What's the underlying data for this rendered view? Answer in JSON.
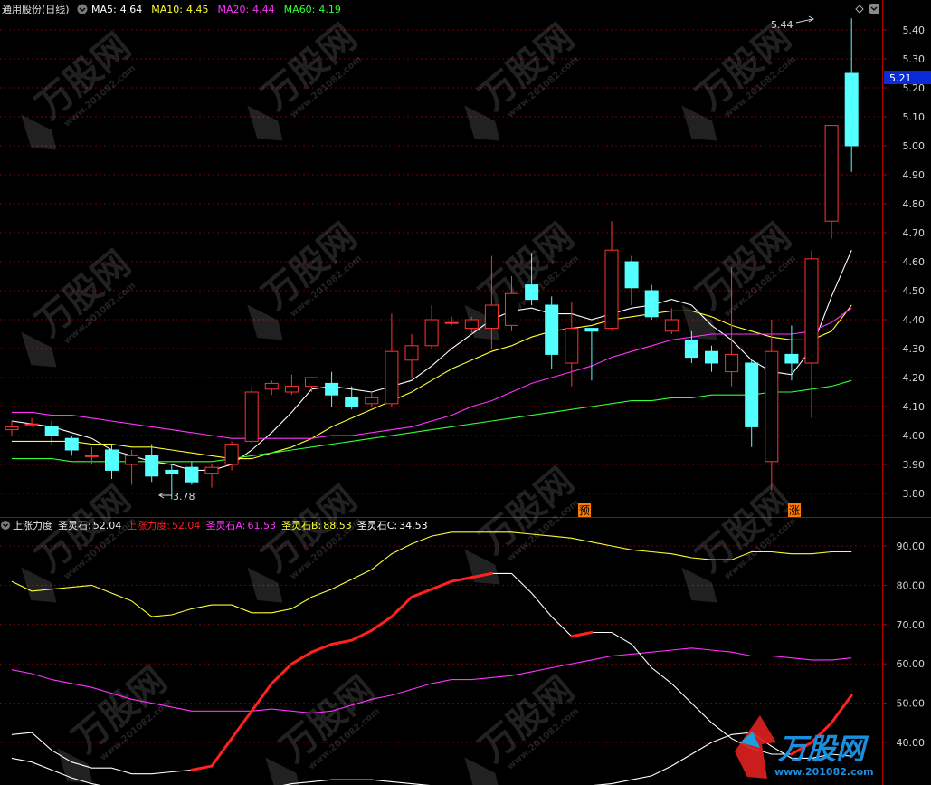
{
  "header": {
    "title": "通用股份(日线)",
    "ma": [
      {
        "label": "MA5:",
        "value": "4.64",
        "color": "#ffffff"
      },
      {
        "label": "MA10:",
        "value": "4.45",
        "color": "#ffff33"
      },
      {
        "label": "MA20:",
        "value": "4.44",
        "color": "#ff33ff"
      },
      {
        "label": "MA60:",
        "value": "4.19",
        "color": "#33ff33"
      }
    ]
  },
  "indicator_header": {
    "name": "上涨力度",
    "name_value_label": "圣灵石:",
    "name_value": "52.04",
    "items": [
      {
        "label": "上涨力度:",
        "value": "52.04",
        "color": "#ff2020"
      },
      {
        "label": "圣灵石A:",
        "value": "61.53",
        "color": "#ff33ff"
      },
      {
        "label": "圣灵石B:",
        "value": "88.53",
        "color": "#ffff33"
      },
      {
        "label": "圣灵石C:",
        "value": "34.53",
        "color": "#ffffff"
      }
    ]
  },
  "markers": {
    "yu": "预",
    "zhang": "涨",
    "high_label": "5.44",
    "low_label": "3.78",
    "current_price": "5.21"
  },
  "watermark": {
    "brand": "万股网",
    "url": "www.201082.com"
  },
  "chart_data": [
    {
      "type": "candlestick",
      "title": "通用股份(日线)",
      "ylim": [
        3.72,
        5.5
      ],
      "y_ticks": [
        3.8,
        3.9,
        4.0,
        4.1,
        4.2,
        4.3,
        4.4,
        4.5,
        4.6,
        4.7,
        4.8,
        4.9,
        5.0,
        5.1,
        5.2,
        5.3,
        5.4
      ],
      "candles": [
        {
          "o": 4.02,
          "h": 4.05,
          "l": 4.0,
          "c": 4.03
        },
        {
          "o": 4.04,
          "h": 4.06,
          "l": 4.03,
          "c": 4.04
        },
        {
          "o": 4.03,
          "h": 4.05,
          "l": 3.97,
          "c": 4.0
        },
        {
          "o": 3.99,
          "h": 4.0,
          "l": 3.93,
          "c": 3.95
        },
        {
          "o": 3.93,
          "h": 3.96,
          "l": 3.9,
          "c": 3.93
        },
        {
          "o": 3.95,
          "h": 3.97,
          "l": 3.85,
          "c": 3.88
        },
        {
          "o": 3.9,
          "h": 3.95,
          "l": 3.83,
          "c": 3.93
        },
        {
          "o": 3.93,
          "h": 3.97,
          "l": 3.84,
          "c": 3.86
        },
        {
          "o": 3.88,
          "h": 3.9,
          "l": 3.78,
          "c": 3.87
        },
        {
          "o": 3.89,
          "h": 3.91,
          "l": 3.83,
          "c": 3.84
        },
        {
          "o": 3.87,
          "h": 3.9,
          "l": 3.82,
          "c": 3.89
        },
        {
          "o": 3.9,
          "h": 3.98,
          "l": 3.88,
          "c": 3.97
        },
        {
          "o": 3.98,
          "h": 4.17,
          "l": 3.97,
          "c": 4.15
        },
        {
          "o": 4.16,
          "h": 4.19,
          "l": 4.14,
          "c": 4.18
        },
        {
          "o": 4.15,
          "h": 4.21,
          "l": 4.14,
          "c": 4.17
        },
        {
          "o": 4.17,
          "h": 4.2,
          "l": 4.15,
          "c": 4.2
        },
        {
          "o": 4.18,
          "h": 4.22,
          "l": 4.1,
          "c": 4.14
        },
        {
          "o": 4.13,
          "h": 4.17,
          "l": 4.09,
          "c": 4.1
        },
        {
          "o": 4.11,
          "h": 4.15,
          "l": 4.1,
          "c": 4.13
        },
        {
          "o": 4.11,
          "h": 4.42,
          "l": 4.1,
          "c": 4.29
        },
        {
          "o": 4.26,
          "h": 4.35,
          "l": 4.2,
          "c": 4.31
        },
        {
          "o": 4.31,
          "h": 4.45,
          "l": 4.3,
          "c": 4.4
        },
        {
          "o": 4.39,
          "h": 4.41,
          "l": 4.38,
          "c": 4.39
        },
        {
          "o": 4.37,
          "h": 4.41,
          "l": 4.35,
          "c": 4.4
        },
        {
          "o": 4.37,
          "h": 4.62,
          "l": 4.3,
          "c": 4.45
        },
        {
          "o": 4.38,
          "h": 4.55,
          "l": 4.36,
          "c": 4.49
        },
        {
          "o": 4.52,
          "h": 4.63,
          "l": 4.45,
          "c": 4.47
        },
        {
          "o": 4.45,
          "h": 4.48,
          "l": 4.23,
          "c": 4.28
        },
        {
          "o": 4.25,
          "h": 4.46,
          "l": 4.17,
          "c": 4.37
        },
        {
          "o": 4.37,
          "h": 4.37,
          "l": 4.19,
          "c": 4.36
        },
        {
          "o": 4.37,
          "h": 4.74,
          "l": 4.36,
          "c": 4.64
        },
        {
          "o": 4.6,
          "h": 4.62,
          "l": 4.45,
          "c": 4.51
        },
        {
          "o": 4.5,
          "h": 4.52,
          "l": 4.4,
          "c": 4.41
        },
        {
          "o": 4.36,
          "h": 4.44,
          "l": 4.35,
          "c": 4.4
        },
        {
          "o": 4.33,
          "h": 4.36,
          "l": 4.25,
          "c": 4.27
        },
        {
          "o": 4.29,
          "h": 4.31,
          "l": 4.22,
          "c": 4.25
        },
        {
          "o": 4.22,
          "h": 4.58,
          "l": 4.17,
          "c": 4.28
        },
        {
          "o": 4.25,
          "h": 4.26,
          "l": 3.96,
          "c": 4.03
        },
        {
          "o": 3.91,
          "h": 4.4,
          "l": 3.81,
          "c": 4.29
        },
        {
          "o": 4.28,
          "h": 4.38,
          "l": 4.19,
          "c": 4.25
        },
        {
          "o": 4.25,
          "h": 4.64,
          "l": 4.06,
          "c": 4.61
        },
        {
          "o": 4.74,
          "h": 5.07,
          "l": 4.68,
          "c": 5.07
        },
        {
          "o": 5.25,
          "h": 5.44,
          "l": 4.91,
          "c": 5.0
        }
      ],
      "series": [
        {
          "name": "MA5",
          "color": "#ffffff",
          "values": [
            4.05,
            4.04,
            4.03,
            4.01,
            3.99,
            3.95,
            3.93,
            3.91,
            3.9,
            3.88,
            3.88,
            3.9,
            3.95,
            4.01,
            4.08,
            4.16,
            4.17,
            4.16,
            4.15,
            4.17,
            4.19,
            4.24,
            4.3,
            4.35,
            4.4,
            4.43,
            4.44,
            4.42,
            4.42,
            4.4,
            4.42,
            4.44,
            4.45,
            4.47,
            4.45,
            4.38,
            4.33,
            4.26,
            4.22,
            4.21,
            4.3,
            4.48,
            4.64
          ]
        },
        {
          "name": "MA10",
          "color": "#ffff33",
          "values": [
            3.98,
            3.98,
            3.98,
            3.98,
            3.97,
            3.97,
            3.96,
            3.96,
            3.95,
            3.94,
            3.93,
            3.92,
            3.92,
            3.94,
            3.96,
            3.99,
            4.03,
            4.06,
            4.09,
            4.12,
            4.15,
            4.19,
            4.23,
            4.26,
            4.29,
            4.31,
            4.34,
            4.36,
            4.37,
            4.38,
            4.4,
            4.41,
            4.42,
            4.43,
            4.43,
            4.41,
            4.38,
            4.36,
            4.34,
            4.33,
            4.33,
            4.36,
            4.45
          ]
        },
        {
          "name": "MA20",
          "color": "#ff33ff",
          "values": [
            4.08,
            4.08,
            4.07,
            4.07,
            4.06,
            4.05,
            4.04,
            4.03,
            4.02,
            4.01,
            4.0,
            3.99,
            3.99,
            3.99,
            3.99,
            3.99,
            4.0,
            4.0,
            4.01,
            4.02,
            4.03,
            4.05,
            4.07,
            4.1,
            4.12,
            4.15,
            4.18,
            4.2,
            4.22,
            4.24,
            4.27,
            4.29,
            4.31,
            4.33,
            4.34,
            4.35,
            4.35,
            4.35,
            4.35,
            4.35,
            4.36,
            4.39,
            4.44
          ]
        },
        {
          "name": "MA60",
          "color": "#33ff33",
          "values": [
            3.92,
            3.92,
            3.92,
            3.91,
            3.91,
            3.91,
            3.91,
            3.91,
            3.91,
            3.91,
            3.91,
            3.92,
            3.93,
            3.94,
            3.95,
            3.96,
            3.97,
            3.98,
            3.99,
            4.0,
            4.01,
            4.02,
            4.03,
            4.04,
            4.05,
            4.06,
            4.07,
            4.08,
            4.09,
            4.1,
            4.11,
            4.12,
            4.12,
            4.13,
            4.13,
            4.14,
            4.14,
            4.14,
            4.15,
            4.15,
            4.16,
            4.17,
            4.19
          ]
        }
      ]
    },
    {
      "type": "line",
      "title": "上涨力度",
      "ylim": [
        27,
        97
      ],
      "y_ticks": [
        40,
        50,
        60,
        70,
        80,
        90
      ],
      "series": [
        {
          "name": "圣灵石B",
          "color": "#ffff33",
          "values": [
            81,
            78.5,
            79,
            79.5,
            80,
            78,
            76,
            72,
            72.5,
            74,
            75,
            75,
            73,
            73,
            74,
            77,
            79,
            81.5,
            84,
            88,
            90.5,
            92.5,
            93.5,
            93.5,
            93.5,
            93.5,
            93,
            92.5,
            92,
            91,
            90,
            89,
            88.5,
            88,
            87,
            86.5,
            86.5,
            88.5,
            88.5,
            88,
            88,
            88.5,
            88.5
          ]
        },
        {
          "name": "圣灵石A",
          "color": "#ff33ff",
          "values": [
            58.5,
            57.5,
            56,
            55,
            54,
            52.5,
            51,
            50,
            49,
            48,
            48,
            48,
            48,
            48.5,
            48,
            47.5,
            48,
            49.5,
            51,
            52,
            53.5,
            55,
            56,
            56,
            56.5,
            57,
            58,
            59,
            60,
            61,
            62,
            62.5,
            63,
            63.5,
            64,
            63.5,
            63,
            62,
            62,
            61.5,
            61,
            61,
            61.5
          ]
        },
        {
          "name": "圣灵石C",
          "color": "#ffffff",
          "values": [
            42,
            42.5,
            38,
            35,
            33.5,
            33.5,
            32,
            32,
            32.5,
            33,
            34,
            41,
            48,
            55,
            60,
            63,
            65,
            66,
            68.5,
            72,
            77,
            79,
            81,
            82,
            83,
            83,
            78,
            72,
            67,
            68,
            68,
            65,
            59,
            55,
            50,
            45,
            41,
            38.5,
            37,
            37,
            40,
            45,
            52
          ]
        },
        {
          "name": "上涨力度",
          "color": "#ff2020",
          "values": [
            42,
            42.5,
            38,
            35,
            33.5,
            33.5,
            32,
            32,
            32.5,
            33,
            34,
            41,
            48,
            55,
            60,
            63,
            65,
            66,
            68.5,
            72,
            77,
            79,
            81,
            82,
            83,
            83,
            78,
            72,
            67,
            68,
            68,
            65,
            59,
            55,
            50,
            45,
            41,
            38.5,
            37,
            37,
            40,
            45,
            52
          ]
        },
        {
          "name": "series_bottom",
          "color": "#ffffff",
          "values": [
            36,
            35,
            33,
            31,
            29.5,
            28.5,
            28,
            27.5,
            27.5,
            27.5,
            27.5,
            27.5,
            28,
            28.5,
            29.5,
            30,
            30.5,
            30.5,
            30.5,
            30,
            29.5,
            29,
            28.5,
            28,
            28,
            28,
            28,
            28.5,
            28.5,
            29,
            29.5,
            30.5,
            31.5,
            34,
            37,
            40,
            42,
            42.5,
            39,
            36,
            36,
            37,
            36.5
          ]
        }
      ]
    }
  ]
}
